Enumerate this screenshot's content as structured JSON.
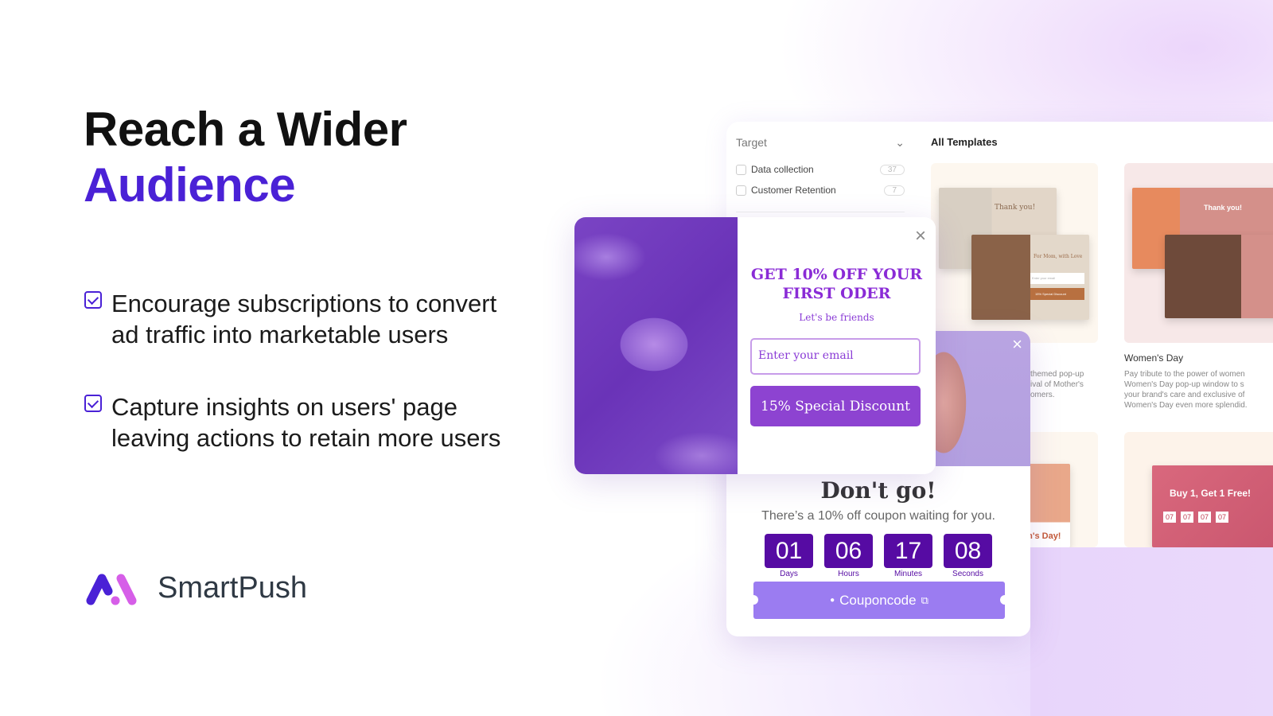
{
  "hero": {
    "title_line1": "Reach a Wider",
    "title_line2": "Audience"
  },
  "bullets": [
    {
      "line1": "Encourage subscriptions to convert",
      "line2": "ad traffic into marketable users"
    },
    {
      "line1": "Capture insights on users' page",
      "line2": "leaving actions to retain more users"
    }
  ],
  "brand": {
    "name": "SmartPush",
    "colors": {
      "accent": "#4a21d6",
      "logo_pink": "#d65ee8"
    }
  },
  "panel": {
    "filter": {
      "label": "Target",
      "items": [
        {
          "label": "Data collection",
          "count": "37"
        },
        {
          "label": "Customer Retention",
          "count": "7"
        }
      ]
    },
    "templates_title": "All Templates",
    "cards": [
      {
        "desc_fragment": "themed pop-up\nival of Mother's\nomers.",
        "mini_title": "Thank you!",
        "mini_title2": "For Mom, with Love",
        "mini_coupon": "Couponcode",
        "mini_email": "Enter your email",
        "mini_button": "15% Special Discount"
      },
      {
        "title": "Women's Day",
        "desc": "Pay tribute to the power of women\nWomen's Day pop-up window to s\nyour brand's care and exclusive of\nWomen's Day even more splendid.",
        "mini_title": "Thank you!"
      },
      {
        "mini_title": "en's Day!"
      },
      {
        "mini_title": "Buy 1, Get 1 Free!",
        "mini_timer": [
          "07",
          "07",
          "07",
          "07"
        ]
      }
    ]
  },
  "popup_subscribe": {
    "title": "GET 10% OFF YOUR FIRST ODER",
    "subtitle": "Let's be friends",
    "email_placeholder": "Enter your email",
    "button": "15% Special Discount",
    "close": "×"
  },
  "popup_exit": {
    "title": "Don't go!",
    "subtitle": "There’s a 10% off coupon waiting for you.",
    "close": "×",
    "timer": [
      {
        "value": "01",
        "label": "Days"
      },
      {
        "value": "06",
        "label": "Hours"
      },
      {
        "value": "17",
        "label": "Minutes"
      },
      {
        "value": "08",
        "label": "Seconds"
      }
    ],
    "coupon": "Couponcode"
  }
}
